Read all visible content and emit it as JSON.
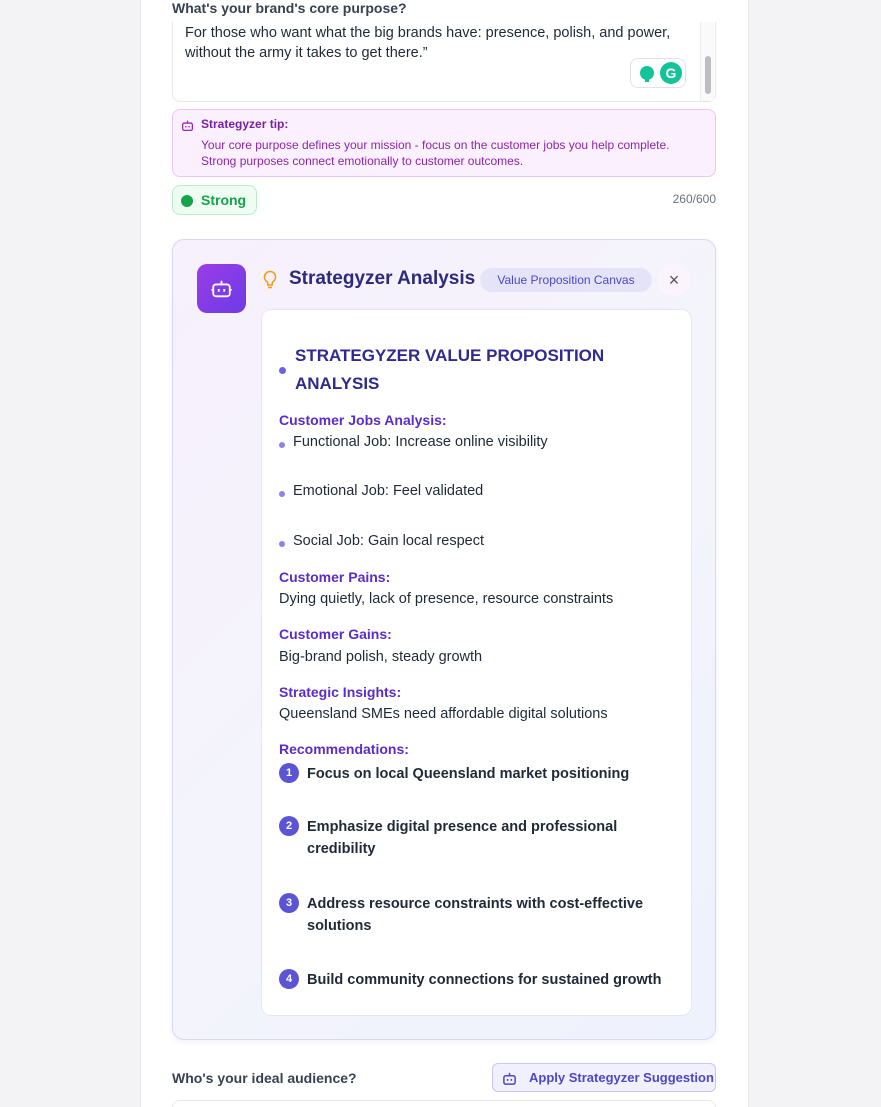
{
  "brand_purpose": {
    "label": "What's your brand's core purpose?",
    "text": "For those who want what the big brands have: presence, polish, and power, without the army it takes to get there.”"
  },
  "tip": {
    "title": "Strategyzer tip:",
    "body": "Your core purpose defines your mission - focus on the customer jobs you help complete. Strong purposes connect emotionally to customer outcomes."
  },
  "strength": {
    "label": "Strong",
    "counter": "260/600",
    "color": "#16a34a"
  },
  "analysis": {
    "title": "Strategyzer Analysis",
    "pill": "Value Proposition Canvas",
    "close": "×",
    "heading": "STRATEGYZER VALUE PROPOSITION ANALYSIS",
    "customer_jobs": {
      "label": "Customer Jobs Analysis:",
      "items": [
        "Functional Job: Increase online visibility",
        "Emotional Job: Feel validated",
        "Social Job: Gain local respect"
      ]
    },
    "pains": {
      "label": "Customer Pains:",
      "text": "Dying quietly, lack of presence, resource constraints"
    },
    "gains": {
      "label": "Customer Gains:",
      "text": "Big-brand polish, steady growth"
    },
    "insights": {
      "label": "Strategic Insights:",
      "text": "Queensland SMEs need affordable digital solutions"
    },
    "recommendations": {
      "label": "Recommendations:",
      "items": [
        {
          "num": "1",
          "text": "Focus on local Queensland market positioning"
        },
        {
          "num": "2",
          "text": "Emphasize digital presence and professional credibility"
        },
        {
          "num": "3",
          "text": "Address resource constraints with cost-effective solutions"
        },
        {
          "num": "4",
          "text": "Build community connections for sustained growth"
        }
      ]
    }
  },
  "audience": {
    "label": "Who's your ideal audience?",
    "apply_button": "Apply Strategyzer Suggestion"
  },
  "colors": {
    "accent": "#5b55d6",
    "heading": "#2f2a91",
    "section": "#5b2cc9",
    "tip_bg": "#fbf1fe"
  }
}
